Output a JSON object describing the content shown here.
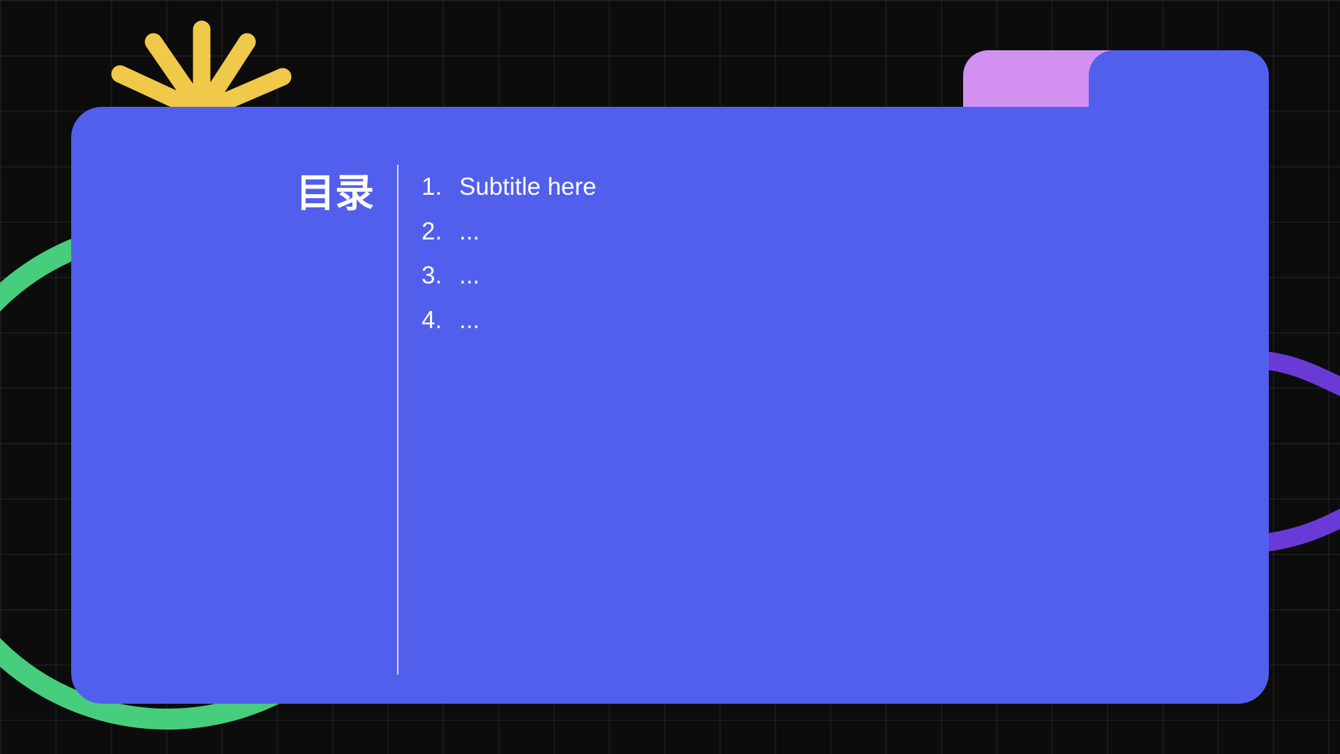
{
  "slide": {
    "title": "目录",
    "toc": [
      {
        "number": "1.",
        "label": "Subtitle here"
      },
      {
        "number": "2.",
        "label": "..."
      },
      {
        "number": "3.",
        "label": "..."
      },
      {
        "number": "4.",
        "label": "..."
      }
    ]
  },
  "colors": {
    "background": "#0c0c0c",
    "card": "#525fec",
    "tab_pink": "#d291f1",
    "sun_yellow": "#f0c84a",
    "ring_green": "#46cd7d",
    "wave_purple": "#6a3ad6",
    "text": "#ffffff"
  },
  "icons": [
    "sunburst-icon"
  ]
}
